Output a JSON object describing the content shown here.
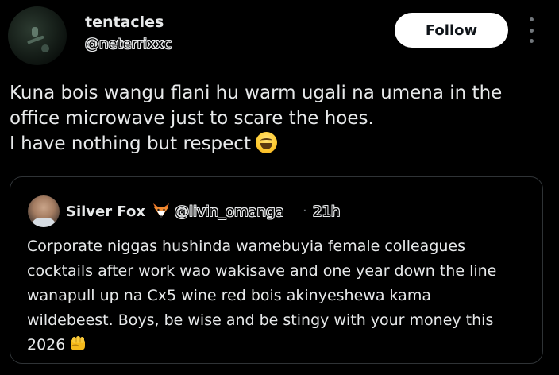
{
  "post": {
    "author": {
      "display_name": "tentacles",
      "handle": "@neterrixxc",
      "avatar_icon": "profile-avatar"
    },
    "follow_label": "Follow",
    "more_icon": "vertical-ellipsis-icon",
    "text_lines": [
      "Kuna bois wangu flani hu warm ugali na umena in the",
      "office microwave just to scare the hoes.",
      "I have nothing but respect"
    ],
    "text_emoji": "laughing-tears-emoji"
  },
  "quote": {
    "author": {
      "display_name": "Silver Fox",
      "name_emoji": "fox-face-emoji",
      "handle": "@livin_omanga",
      "separator": "·",
      "time": "21h"
    },
    "text_lines": [
      "Corporate niggas hushinda wamebuyia female colleagues",
      "cocktails after work wao wakisave and one year down the line",
      "wanapull up na Cx5 wine red bois akinyeshewa kama",
      "wildebeest. Boys, be wise and be stingy with your money this",
      "2026"
    ],
    "text_emoji": "oncoming-fist-emoji"
  },
  "colors": {
    "background": "#000000",
    "text": "#e7e9ea",
    "muted": "#71767b",
    "border": "#2f3336",
    "follow_bg": "#ffffff"
  }
}
